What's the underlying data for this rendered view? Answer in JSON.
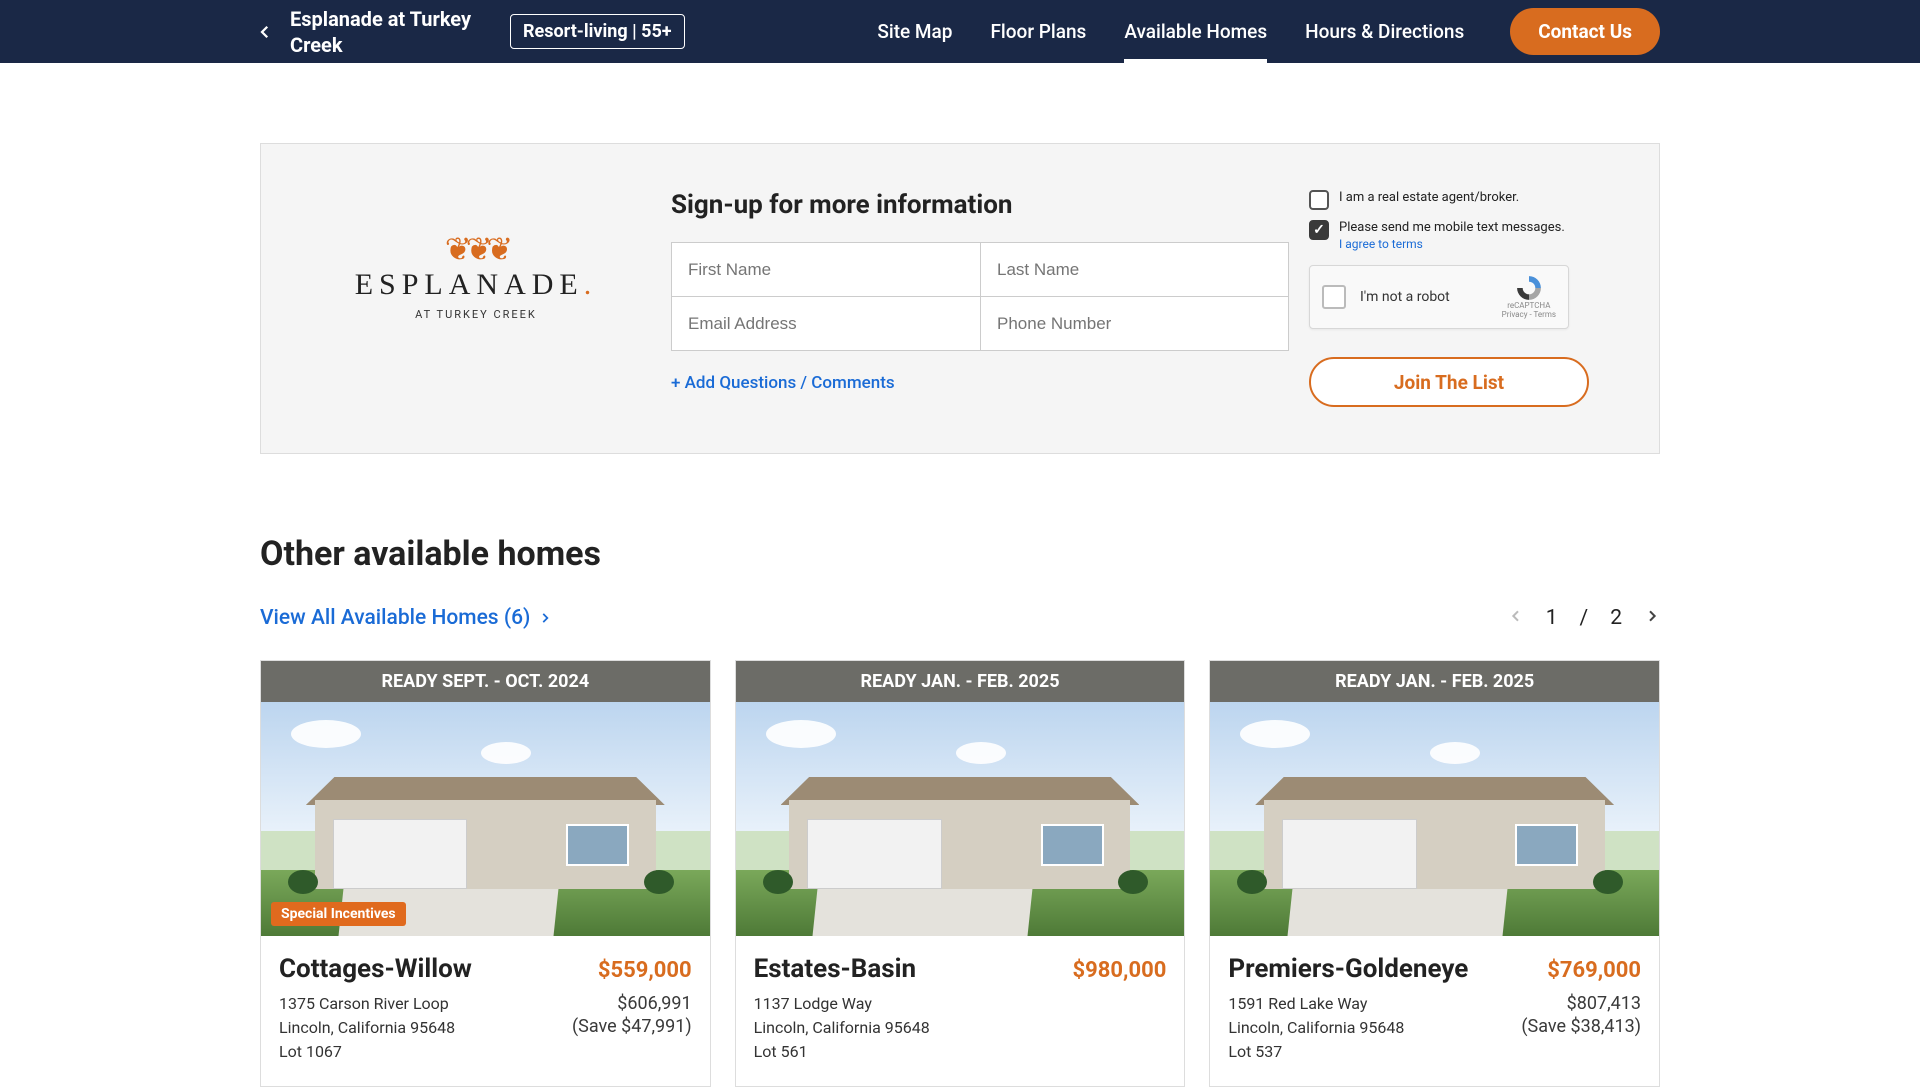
{
  "nav": {
    "community_name": "Esplanade at Turkey Creek",
    "badge": "Resort-living | 55+",
    "links": {
      "site_map": "Site Map",
      "floor_plans": "Floor Plans",
      "available": "Available Homes",
      "hours": "Hours & Directions"
    },
    "cta": "Contact Us"
  },
  "signup": {
    "title": "Sign-up for more information",
    "logo": {
      "name": "ESPLANADE",
      "sub": "AT TURKEY CREEK"
    },
    "fields": {
      "first": "First Name",
      "last": "Last Name",
      "email": "Email Address",
      "phone": "Phone Number"
    },
    "add_comments": "+ Add Questions / Comments",
    "opts": {
      "agent": "I am a real estate agent/broker.",
      "sms": "Please send me mobile text messages.",
      "terms": "I agree to terms"
    },
    "recaptcha": {
      "txt": "I'm not a robot",
      "name": "reCAPTCHA",
      "fine": "Privacy - Terms"
    },
    "join": "Join The List"
  },
  "section": {
    "title": "Other available homes",
    "view_all": "View All Available Homes (6)",
    "pager": {
      "current": "1",
      "sep": "/",
      "total": "2"
    }
  },
  "cards": [
    {
      "ready": "READY SEPT. - OCT. 2024",
      "incentive": "Special Incentives",
      "plan": "Cottages-Willow",
      "price": "$559,000",
      "old": "$606,991",
      "save": "(Save $47,991)",
      "addr1": "1375 Carson River Loop",
      "addr2": "Lincoln, California 95648",
      "lot": "Lot 1067"
    },
    {
      "ready": "READY JAN. - FEB. 2025",
      "incentive": "",
      "plan": "Estates-Basin",
      "price": "$980,000",
      "old": "",
      "save": "",
      "addr1": "1137 Lodge Way",
      "addr2": "Lincoln, California 95648",
      "lot": "Lot 561"
    },
    {
      "ready": "READY JAN. - FEB. 2025",
      "incentive": "",
      "plan": "Premiers-Goldeneye",
      "price": "$769,000",
      "old": "$807,413",
      "save": "(Save $38,413)",
      "addr1": "1591 Red Lake Way",
      "addr2": "Lincoln, California 95648",
      "lot": "Lot 537"
    }
  ]
}
